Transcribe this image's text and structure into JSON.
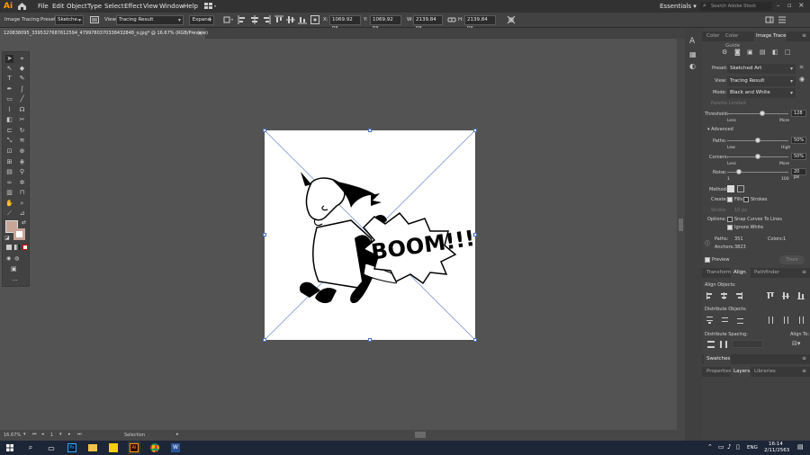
{
  "app": {
    "logo": "Ai",
    "workspace": "Essentials",
    "search_placeholder": "Search Adobe Stock"
  },
  "menu": [
    "File",
    "Edit",
    "Object",
    "Type",
    "Select",
    "Effect",
    "View",
    "Window",
    "Help"
  ],
  "control": {
    "mode": "Image Tracing",
    "preset_label": "Preset:",
    "preset_value": "Sketche...",
    "view_label": "View:",
    "view_value": "Tracing Result",
    "expand": "Expand",
    "x_label": "X:",
    "x_value": "1069.92 px",
    "y_label": "Y:",
    "y_value": "1069.92 px",
    "w_label": "W:",
    "w_value": "2139.84 px",
    "h_label": "H:",
    "h_value": "2139.84 px"
  },
  "document": {
    "tab_title": "120838095_3395327687612594_4799780370338432848_o.jpg* @ 16.67% (RGB/Preview)",
    "close": "×"
  },
  "artwork": {
    "boom_text": "BOOM!!!"
  },
  "status": {
    "zoom": "16.67%",
    "page": "1",
    "tool": "Selection"
  },
  "panel_tabs": [
    "Color",
    "Color Guide",
    "Image Trace"
  ],
  "trace": {
    "preset_label": "Preset:",
    "preset_value": "Sketched Art",
    "view_label": "View:",
    "view_value": "Tracing Result",
    "mode_label": "Mode:",
    "mode_value": "Black and White",
    "palette_label": "Palette:",
    "palette_value": "Limited",
    "threshold_label": "Threshold:",
    "threshold_value": "128",
    "threshold_pct": 0.57,
    "less": "Less",
    "more": "More",
    "advanced": "Advanced",
    "paths_label": "Paths:",
    "paths_value": "50%",
    "paths_pct": 0.5,
    "low": "Low",
    "high": "High",
    "corners_label": "Corners:",
    "corners_value": "50%",
    "corners_pct": 0.5,
    "noise_label": "Noise:",
    "noise_value": "20 px",
    "noise_min": "1",
    "noise_max": "100",
    "noise_pct": 0.19,
    "method_label": "Method:",
    "create_label": "Create:",
    "fills": "Fills",
    "strokes": "Strokes",
    "stroke_label": "Stroke:",
    "stroke_value": "10 px",
    "options_label": "Options:",
    "snap": "Snap Curves To Lines",
    "ignore": "Ignore White",
    "paths_count_label": "Paths:",
    "paths_count": "351",
    "colors_label": "Colors:",
    "colors_count": "1",
    "anchors_label": "Anchors:",
    "anchors_count": "3823",
    "preview": "Preview",
    "trace_btn": "Trace"
  },
  "align_tabs": [
    "Transform",
    "Align",
    "Pathfinder"
  ],
  "align": {
    "objects": "Align Objects:",
    "distribute": "Distribute Objects:",
    "spacing": "Distribute Spacing:",
    "align_to": "Align To:"
  },
  "swatches": "Swatches",
  "bottom_tabs": [
    "Properties",
    "Layers",
    "Libraries"
  ],
  "taskbar": {
    "lang": "ENG",
    "time": "16:14",
    "date": "2/11/2563"
  },
  "colors": {
    "fill": "#c8a697",
    "accent": "#ff7c00"
  }
}
